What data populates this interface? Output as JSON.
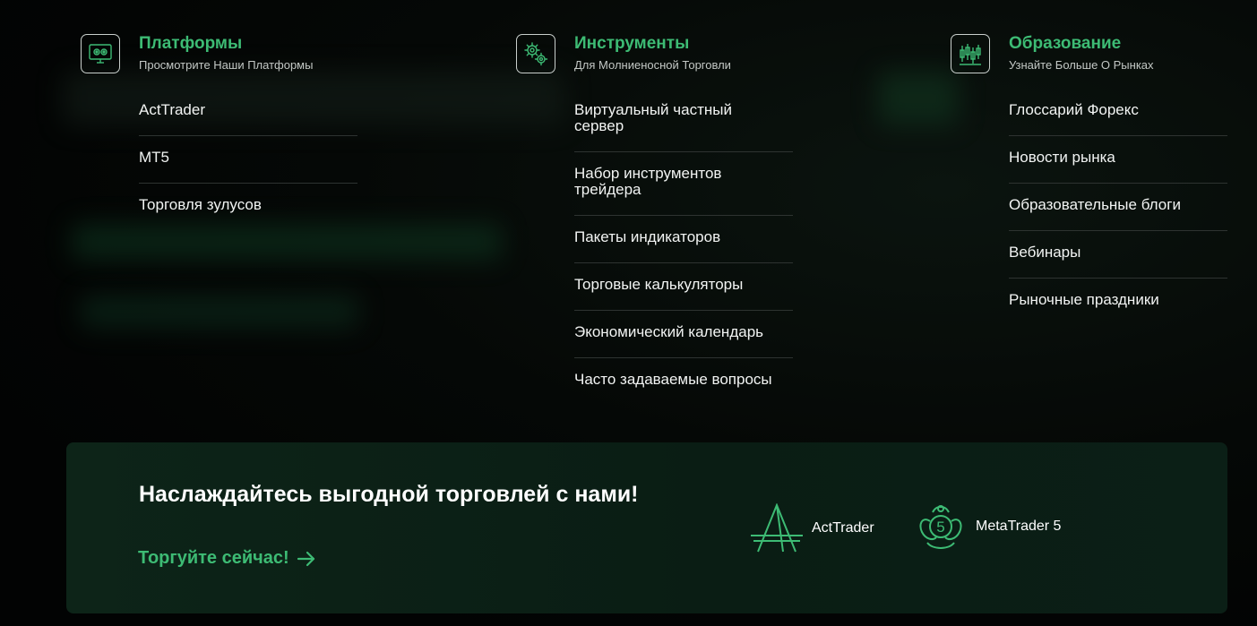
{
  "columns": [
    {
      "icon": "monitor-settings-icon",
      "title": "Платформы",
      "subtitle": "Просмотрите Наши Платформы",
      "items": [
        "ActTrader",
        "MT5",
        "Торговля зулусов"
      ]
    },
    {
      "icon": "gears-icon",
      "title": "Инструменты",
      "subtitle": "Для Молниеносной Торговли",
      "items": [
        "Виртуальный частный сервер",
        "Набор инструментов трейдера",
        "Пакеты индикаторов",
        "Торговые калькуляторы",
        "Экономический календарь",
        "Часто задаваемые вопросы"
      ]
    },
    {
      "icon": "candlestick-chart-icon",
      "title": "Образование",
      "subtitle": "Узнайте Больше О Рынках",
      "items": [
        "Глоссарий Форекс",
        "Новости рынка",
        "Образовательные блоги",
        "Вебинары",
        "Рыночные праздники"
      ]
    }
  ],
  "cta": {
    "title": "Наслаждайтесь выгодной торговлей с нами!",
    "link_label": "Торгуйте сейчас!",
    "link_icon": "arrow-right-icon",
    "brands": [
      {
        "icon": "acttrader-logo",
        "label": "ActTrader"
      },
      {
        "icon": "metatrader5-logo",
        "label": "MetaTrader 5"
      }
    ]
  },
  "colors": {
    "accent": "#3dbb74",
    "background": "#020303",
    "cta_background": "#0b2016",
    "text": "#f2f4f3",
    "divider": "#2e3331"
  }
}
